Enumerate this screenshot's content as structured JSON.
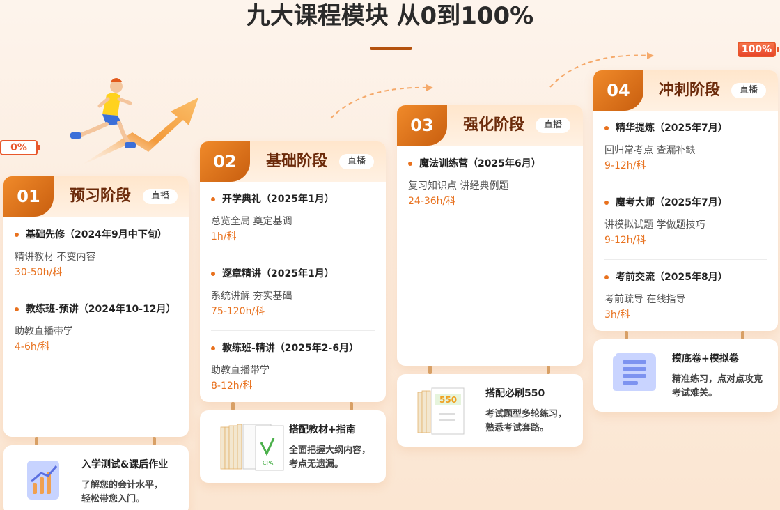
{
  "page": {
    "title": "九大课程模块 从0到100%",
    "battery_start": "0%",
    "battery_end": "100%"
  },
  "stages": [
    {
      "num": "01",
      "name": "预习阶段",
      "badge": "直播",
      "items": [
        {
          "title": "基础先修（2024年9月中下旬）",
          "desc": "精讲教材 不变内容",
          "hours": "30-50h/科"
        },
        {
          "title": "教练班-预讲（2024年10-12月）",
          "desc": "助教直播带学",
          "hours": "4-6h/科"
        }
      ],
      "support": {
        "title": "入学测试&课后作业",
        "desc_lines": [
          "了解您的会计水平，",
          "轻松带您入门。"
        ],
        "icon": "chart-icon"
      }
    },
    {
      "num": "02",
      "name": "基础阶段",
      "badge": "直播",
      "items": [
        {
          "title": "开学典礼（2025年1月）",
          "desc": "总览全局 奠定基调",
          "hours": "1h/科"
        },
        {
          "title": "逐章精讲（2025年1月）",
          "desc": "系统讲解 夯实基础",
          "hours": "75-120h/科"
        },
        {
          "title": "教练班-精讲（2025年2-6月）",
          "desc": "助教直播带学",
          "hours": "8-12h/科"
        }
      ],
      "support": {
        "title": "搭配教材+指南",
        "desc_lines": [
          "全面把握大纲内容，",
          "考点无遗漏。"
        ],
        "icon": "books-icon",
        "book_label": "CPA"
      }
    },
    {
      "num": "03",
      "name": "强化阶段",
      "badge": "直播",
      "items": [
        {
          "title": "魔法训练营（2025年6月）",
          "desc": "复习知识点 讲经典例题",
          "hours": "24-36h/科"
        }
      ],
      "support": {
        "title": "搭配必刷550",
        "desc_lines": [
          "考试题型多轮练习，",
          "熟悉考试套路。"
        ],
        "icon": "books-550-icon",
        "book_label": "550"
      }
    },
    {
      "num": "04",
      "name": "冲刺阶段",
      "badge": "直播",
      "items": [
        {
          "title": "精华提炼（2025年7月）",
          "desc": "回归常考点 查漏补缺",
          "hours": "9-12h/科"
        },
        {
          "title": "魔考大师（2025年7月）",
          "desc": "讲模拟试题 学做题技巧",
          "hours": "9-12h/科"
        },
        {
          "title": "考前交流（2025年8月）",
          "desc": "考前疏导 在线指导",
          "hours": "3h/科"
        }
      ],
      "support": {
        "title": "摸底卷+模拟卷",
        "desc_lines": [
          "精准练习，点对点攻克",
          "考试难关。"
        ],
        "icon": "scroll-icon"
      }
    }
  ],
  "colors": {
    "accent": "#e8711e",
    "stage_num": "#c85e0f",
    "battery": "#e8572b",
    "stage_name": "#6b2a0a"
  }
}
